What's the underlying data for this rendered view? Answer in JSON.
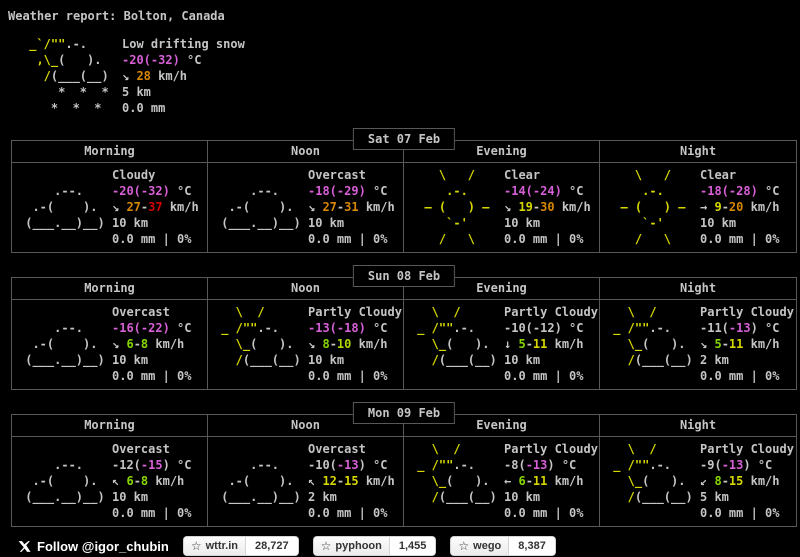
{
  "palette": {
    "fg": "#c5c5c5",
    "sun": "#d7d700",
    "green": "#87d700",
    "ygreen": "#afd700",
    "yellow": "#d7d700",
    "orange": "#d78700",
    "red": "#d70000",
    "magenta": "#d75fd7"
  },
  "header": {
    "title": "Weather report: Bolton, Canada"
  },
  "arts": {
    "snow_showers": [
      [
        {
          "t": " _`/\"\"",
          "c": "sun"
        },
        {
          "t": ".-.",
          "c": "fg"
        }
      ],
      [
        {
          "t": "  ,\\_",
          "c": "sun"
        },
        {
          "t": "(   ).",
          "c": "fg"
        }
      ],
      [
        {
          "t": "   /",
          "c": "sun"
        },
        {
          "t": "(___(__)",
          "c": "fg"
        }
      ],
      [
        {
          "t": "     *  *  *",
          "c": "fg"
        }
      ],
      [
        {
          "t": "    *  *  *",
          "c": "fg"
        }
      ]
    ],
    "cloudy": [
      [
        {
          "t": " ",
          "c": "fg"
        }
      ],
      [
        {
          "t": "     .--.",
          "c": "fg"
        }
      ],
      [
        {
          "t": "  .-(    ).",
          "c": "fg"
        }
      ],
      [
        {
          "t": " (___.__)__)",
          "c": "fg"
        }
      ]
    ],
    "sunny": [
      [
        {
          "t": "    \\   /",
          "c": "sun"
        }
      ],
      [
        {
          "t": "     .-.",
          "c": "sun"
        }
      ],
      [
        {
          "t": "  – (   ) –",
          "c": "sun"
        }
      ],
      [
        {
          "t": "     `-'",
          "c": "sun"
        }
      ],
      [
        {
          "t": "    /   \\",
          "c": "sun"
        }
      ]
    ],
    "partly": [
      [
        {
          "t": "   \\  /",
          "c": "sun"
        }
      ],
      [
        {
          "t": " _ /\"\"",
          "c": "sun"
        },
        {
          "t": ".-.",
          "c": "fg"
        }
      ],
      [
        {
          "t": "   \\_",
          "c": "sun"
        },
        {
          "t": "(   ).",
          "c": "fg"
        }
      ],
      [
        {
          "t": "   /",
          "c": "sun"
        },
        {
          "t": "(___(__)",
          "c": "fg"
        }
      ]
    ]
  },
  "current": {
    "art": "snow_showers",
    "condition": "Low drifting snow",
    "temp": [
      {
        "t": "-20(-32)",
        "c": "magenta"
      },
      {
        "t": " °C",
        "c": "fg"
      }
    ],
    "wind": [
      {
        "t": "↘ ",
        "c": "fg"
      },
      {
        "t": "28",
        "c": "orange"
      },
      {
        "t": " km/h",
        "c": "fg"
      }
    ],
    "visibility": "5 km",
    "precip": "0.0 mm"
  },
  "columns": [
    "Morning",
    "Noon",
    "Evening",
    "Night"
  ],
  "days": [
    {
      "date": "Sat 07 Feb",
      "cells": [
        {
          "art": "cloudy",
          "condition": "Cloudy",
          "temp": [
            {
              "t": "-20(-32)",
              "c": "magenta"
            },
            {
              "t": " °C",
              "c": "fg"
            }
          ],
          "wind": [
            {
              "t": "↘ ",
              "c": "fg"
            },
            {
              "t": "27",
              "c": "orange"
            },
            {
              "t": "-",
              "c": "fg"
            },
            {
              "t": "37",
              "c": "red"
            },
            {
              "t": " km/h",
              "c": "fg"
            }
          ],
          "visibility": "10 km",
          "precip": "0.0 mm | 0%"
        },
        {
          "art": "cloudy",
          "condition": "Overcast",
          "temp": [
            {
              "t": "-18(-29)",
              "c": "magenta"
            },
            {
              "t": " °C",
              "c": "fg"
            }
          ],
          "wind": [
            {
              "t": "↘ ",
              "c": "fg"
            },
            {
              "t": "27",
              "c": "orange"
            },
            {
              "t": "-",
              "c": "fg"
            },
            {
              "t": "31",
              "c": "orange"
            },
            {
              "t": " km/h",
              "c": "fg"
            }
          ],
          "visibility": "10 km",
          "precip": "0.0 mm | 0%"
        },
        {
          "art": "sunny",
          "condition": "Clear",
          "temp": [
            {
              "t": "-14(-24)",
              "c": "magenta"
            },
            {
              "t": " °C",
              "c": "fg"
            }
          ],
          "wind": [
            {
              "t": "↘ ",
              "c": "fg"
            },
            {
              "t": "19",
              "c": "yellow"
            },
            {
              "t": "-",
              "c": "fg"
            },
            {
              "t": "30",
              "c": "orange"
            },
            {
              "t": " km/h",
              "c": "fg"
            }
          ],
          "visibility": "10 km",
          "precip": "0.0 mm | 0%"
        },
        {
          "art": "sunny",
          "condition": "Clear",
          "temp": [
            {
              "t": "-18(-28)",
              "c": "magenta"
            },
            {
              "t": " °C",
              "c": "fg"
            }
          ],
          "wind": [
            {
              "t": "→ ",
              "c": "fg"
            },
            {
              "t": "9",
              "c": "yellow"
            },
            {
              "t": "-",
              "c": "fg"
            },
            {
              "t": "20",
              "c": "orange"
            },
            {
              "t": " km/h",
              "c": "fg"
            }
          ],
          "visibility": "10 km",
          "precip": "0.0 mm | 0%"
        }
      ]
    },
    {
      "date": "Sun 08 Feb",
      "cells": [
        {
          "art": "cloudy",
          "condition": "Overcast",
          "temp": [
            {
              "t": "-16(-22)",
              "c": "magenta"
            },
            {
              "t": " °C",
              "c": "fg"
            }
          ],
          "wind": [
            {
              "t": "↘ ",
              "c": "fg"
            },
            {
              "t": "6",
              "c": "green"
            },
            {
              "t": "-",
              "c": "fg"
            },
            {
              "t": "8",
              "c": "green"
            },
            {
              "t": " km/h",
              "c": "fg"
            }
          ],
          "visibility": "10 km",
          "precip": "0.0 mm | 0%"
        },
        {
          "art": "partly",
          "condition": "Partly Cloudy",
          "temp": [
            {
              "t": "-13(-18)",
              "c": "magenta"
            },
            {
              "t": " °C",
              "c": "fg"
            }
          ],
          "wind": [
            {
              "t": "↘ ",
              "c": "fg"
            },
            {
              "t": "8",
              "c": "green"
            },
            {
              "t": "-",
              "c": "fg"
            },
            {
              "t": "10",
              "c": "ygreen"
            },
            {
              "t": " km/h",
              "c": "fg"
            }
          ],
          "visibility": "10 km",
          "precip": "0.0 mm | 0%"
        },
        {
          "art": "partly",
          "condition": "Partly Cloudy",
          "temp": [
            {
              "t": "-10(-12)",
              "c": "fg"
            },
            {
              "t": " °C",
              "c": "fg"
            }
          ],
          "wind": [
            {
              "t": "↓ ",
              "c": "fg"
            },
            {
              "t": "5",
              "c": "green"
            },
            {
              "t": "-",
              "c": "fg"
            },
            {
              "t": "11",
              "c": "yellow"
            },
            {
              "t": " km/h",
              "c": "fg"
            }
          ],
          "visibility": "10 km",
          "precip": "0.0 mm | 0%"
        },
        {
          "art": "partly",
          "condition": "Partly Cloudy",
          "temp": [
            {
              "t": "-11(",
              "c": "fg"
            },
            {
              "t": "-13",
              "c": "magenta"
            },
            {
              "t": ")",
              "c": "fg"
            },
            {
              "t": " °C",
              "c": "fg"
            }
          ],
          "wind": [
            {
              "t": "↘ ",
              "c": "fg"
            },
            {
              "t": "5",
              "c": "green"
            },
            {
              "t": "-",
              "c": "fg"
            },
            {
              "t": "11",
              "c": "yellow"
            },
            {
              "t": " km/h",
              "c": "fg"
            }
          ],
          "visibility": "2 km",
          "precip": "0.0 mm | 0%"
        }
      ]
    },
    {
      "date": "Mon 09 Feb",
      "cells": [
        {
          "art": "cloudy",
          "condition": "Overcast",
          "temp": [
            {
              "t": "-12(",
              "c": "fg"
            },
            {
              "t": "-15",
              "c": "magenta"
            },
            {
              "t": ")",
              "c": "fg"
            },
            {
              "t": " °C",
              "c": "fg"
            }
          ],
          "wind": [
            {
              "t": "↖ ",
              "c": "fg"
            },
            {
              "t": "6",
              "c": "green"
            },
            {
              "t": "-",
              "c": "fg"
            },
            {
              "t": "8",
              "c": "green"
            },
            {
              "t": " km/h",
              "c": "fg"
            }
          ],
          "visibility": "10 km",
          "precip": "0.0 mm | 0%"
        },
        {
          "art": "cloudy",
          "condition": "Overcast",
          "temp": [
            {
              "t": "-10(",
              "c": "fg"
            },
            {
              "t": "-13",
              "c": "magenta"
            },
            {
              "t": ")",
              "c": "fg"
            },
            {
              "t": " °C",
              "c": "fg"
            }
          ],
          "wind": [
            {
              "t": "↖ ",
              "c": "fg"
            },
            {
              "t": "12",
              "c": "yellow"
            },
            {
              "t": "-",
              "c": "fg"
            },
            {
              "t": "15",
              "c": "yellow"
            },
            {
              "t": " km/h",
              "c": "fg"
            }
          ],
          "visibility": "2 km",
          "precip": "0.0 mm | 0%"
        },
        {
          "art": "partly",
          "condition": "Partly Cloudy",
          "temp": [
            {
              "t": "-8(",
              "c": "fg"
            },
            {
              "t": "-13",
              "c": "magenta"
            },
            {
              "t": ")",
              "c": "fg"
            },
            {
              "t": " °C",
              "c": "fg"
            }
          ],
          "wind": [
            {
              "t": "← ",
              "c": "fg"
            },
            {
              "t": "6",
              "c": "green"
            },
            {
              "t": "-",
              "c": "fg"
            },
            {
              "t": "11",
              "c": "yellow"
            },
            {
              "t": " km/h",
              "c": "fg"
            }
          ],
          "visibility": "10 km",
          "precip": "0.0 mm | 0%"
        },
        {
          "art": "partly",
          "condition": "Partly Cloudy",
          "temp": [
            {
              "t": "-9(",
              "c": "fg"
            },
            {
              "t": "-13",
              "c": "magenta"
            },
            {
              "t": ")",
              "c": "fg"
            },
            {
              "t": " °C",
              "c": "fg"
            }
          ],
          "wind": [
            {
              "t": "↙ ",
              "c": "fg"
            },
            {
              "t": "8",
              "c": "green"
            },
            {
              "t": "-",
              "c": "fg"
            },
            {
              "t": "15",
              "c": "yellow"
            },
            {
              "t": " km/h",
              "c": "fg"
            }
          ],
          "visibility": "5 km",
          "precip": "0.0 mm | 0%"
        }
      ]
    }
  ],
  "footer": {
    "follow_label": "Follow @igor_chubin",
    "star_icon": "☆",
    "repos": [
      {
        "name": "wttr.in",
        "count": "28,727"
      },
      {
        "name": "pyphoon",
        "count": "1,455"
      },
      {
        "name": "wego",
        "count": "8,387"
      }
    ]
  }
}
